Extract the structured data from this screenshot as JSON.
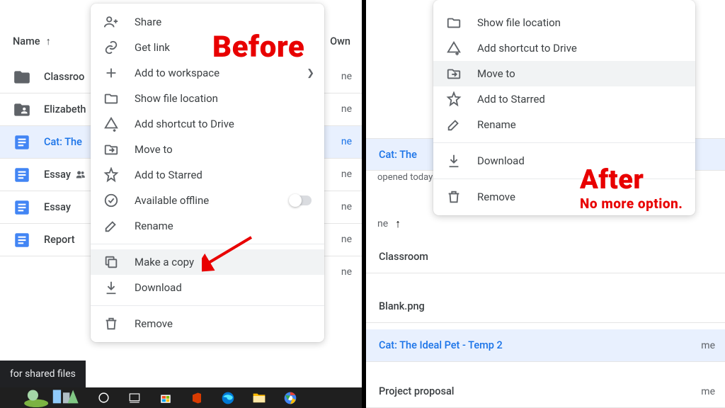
{
  "left": {
    "header_name": "Name",
    "header_owner": "Own",
    "files": [
      {
        "icon": "folder",
        "name": "Classroo"
      },
      {
        "icon": "folder-shared",
        "name": "Elizabeth"
      },
      {
        "icon": "doc",
        "name": "Cat: The",
        "selected": true
      },
      {
        "icon": "doc",
        "name": "Essay"
      },
      {
        "icon": "doc",
        "name": "Essay"
      },
      {
        "icon": "doc",
        "name": "Report"
      }
    ],
    "owners": [
      "ne",
      "ne",
      "ne",
      "ne",
      "ne",
      "ne",
      "ne"
    ],
    "menu": [
      {
        "icon": "person-add",
        "label": "Share"
      },
      {
        "icon": "link",
        "label": "Get link"
      },
      {
        "icon": "plus",
        "label": "Add to workspace",
        "submenu": true
      },
      {
        "icon": "folder-outline",
        "label": "Show file location"
      },
      {
        "icon": "drive-shortcut",
        "label": "Add shortcut to Drive"
      },
      {
        "icon": "move",
        "label": "Move to"
      },
      {
        "icon": "star",
        "label": "Add to Starred"
      },
      {
        "icon": "offline",
        "label": "Available offline",
        "toggle": true
      },
      {
        "icon": "edit",
        "label": "Rename"
      },
      {
        "sep": true
      },
      {
        "icon": "copy",
        "label": "Make a copy",
        "hover": true
      },
      {
        "icon": "download",
        "label": "Download"
      },
      {
        "sep": true
      },
      {
        "icon": "trash",
        "label": "Remove"
      }
    ],
    "toast": "for shared files",
    "annotation": "Before"
  },
  "right": {
    "menu": [
      {
        "icon": "folder-outline",
        "label": "Show file location"
      },
      {
        "icon": "drive-shortcut",
        "label": "Add shortcut to Drive"
      },
      {
        "icon": "move",
        "label": "Move to",
        "hover": true
      },
      {
        "icon": "star",
        "label": "Add to Starred"
      },
      {
        "icon": "edit",
        "label": "Rename"
      },
      {
        "sep": true
      },
      {
        "icon": "download",
        "label": "Download"
      },
      {
        "sep": true
      },
      {
        "icon": "trash",
        "label": "Remove"
      }
    ],
    "file_selected": "Cat: The Ideal Pet - Temp 2",
    "file_selected_sub": "opened today",
    "file_selected_short": "Cat: The",
    "files": [
      {
        "name": "Classroom"
      },
      {
        "name": "Blank.png"
      },
      {
        "name": "Cat: The Ideal Pet - Temp 2",
        "selected": true
      },
      {
        "name": "Project proposal"
      }
    ],
    "me": "me",
    "header_name": "ne",
    "annotation_title": "After",
    "annotation_sub": "No more option."
  }
}
